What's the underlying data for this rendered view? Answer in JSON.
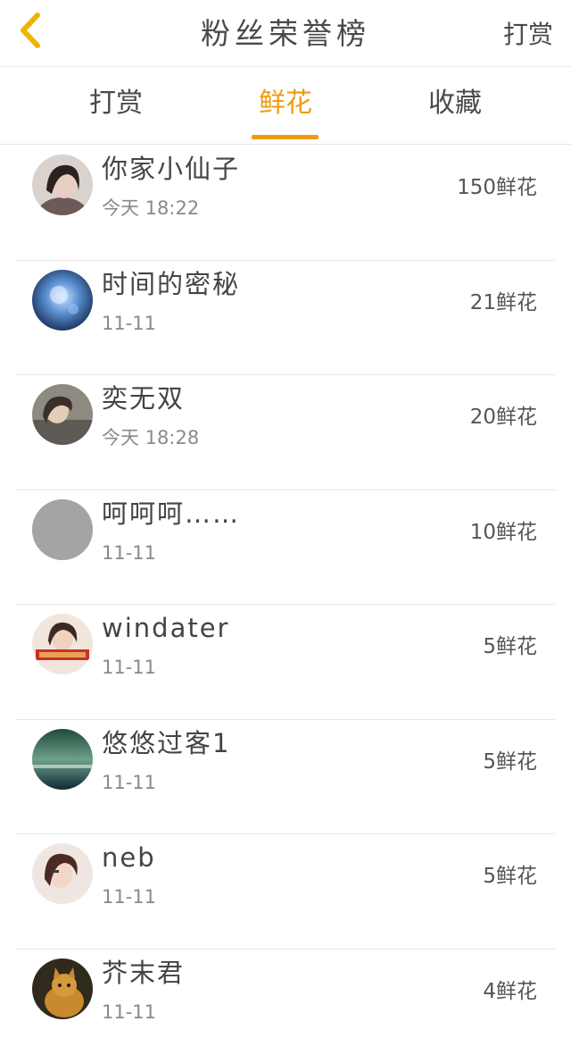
{
  "header": {
    "title": "粉丝荣誉榜",
    "action_label": "打赏",
    "back_icon": "chevron-left-icon",
    "accent_color": "#f0b400"
  },
  "tabs": [
    {
      "label": "打赏",
      "active": false
    },
    {
      "label": "鲜花",
      "active": true
    },
    {
      "label": "收藏",
      "active": false
    }
  ],
  "active_color": "#ee9b10",
  "list": [
    {
      "name": "你家小仙子",
      "time": "今天 18:22",
      "amount": "150鲜花"
    },
    {
      "name": "时间的密秘",
      "time": "11-11",
      "amount": "21鲜花"
    },
    {
      "name": "奕无双",
      "time": "今天 18:28",
      "amount": "20鲜花"
    },
    {
      "name": "呵呵呵……",
      "time": "11-11",
      "amount": "10鲜花"
    },
    {
      "name": "windater",
      "time": "11-11",
      "amount": "5鲜花"
    },
    {
      "name": "悠悠过客1",
      "time": "11-11",
      "amount": "5鲜花"
    },
    {
      "name": "neb",
      "time": "11-11",
      "amount": "5鲜花"
    },
    {
      "name": "芥末君",
      "time": "11-11",
      "amount": "4鲜花"
    }
  ]
}
